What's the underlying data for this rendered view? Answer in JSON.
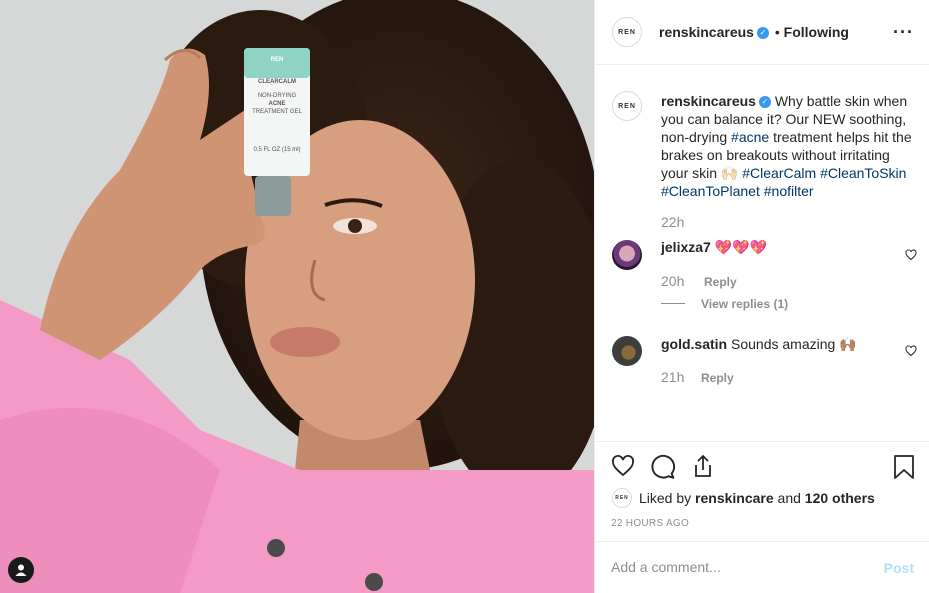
{
  "post": {
    "username": "renskincareus",
    "follow_state": "Following",
    "dot": "•",
    "avatar_text": "REN"
  },
  "caption": {
    "username": "renskincareus",
    "text_1": "Why battle skin when you can balance it? Our NEW soothing, non-drying ",
    "tag_acne": "#acne",
    "text_2": " treatment helps hit the brakes on breakouts without irritating your skin ",
    "emoji": "🙌🏻",
    "tag_clearcalm": "#ClearCalm",
    "tag_cleantoskin": "#CleanToSkin",
    "tag_cleantoplanet": "#CleanToPlanet",
    "tag_nofilter": "#nofilter",
    "time": "22h"
  },
  "comments": [
    {
      "username": "jelixza7",
      "text": "💖💖💖",
      "time": "20h",
      "reply": "Reply",
      "view_replies": "View replies (1)"
    },
    {
      "username": "gold.satin",
      "text": "Sounds amazing 🙌🏽",
      "time": "21h",
      "reply": "Reply"
    }
  ],
  "likes": {
    "prefix": "Liked by ",
    "user": "renskincare",
    "middle": " and ",
    "count": "120 others"
  },
  "timestamp": "22 HOURS AGO",
  "add_comment": {
    "placeholder": "Add a comment...",
    "post_label": "Post"
  },
  "product": {
    "brand": "REN",
    "line": "CLEARCALM",
    "name_1": "NON-DRYING",
    "name_2": "ACNE",
    "name_3": "TREATMENT GEL",
    "size": "0.5 FL OZ (15 ml)"
  },
  "icons": {
    "verified": "verified-badge-icon",
    "more": "more-options-icon",
    "heart": "heart-icon",
    "comment": "comment-icon",
    "share": "share-icon",
    "save": "bookmark-icon",
    "user": "user-tag-icon"
  },
  "colors": {
    "link": "#00376b",
    "verified": "#3897f0",
    "muted": "#8e8e8e",
    "post_disabled": "#b2dffc",
    "shirt": "#f39ac6"
  }
}
